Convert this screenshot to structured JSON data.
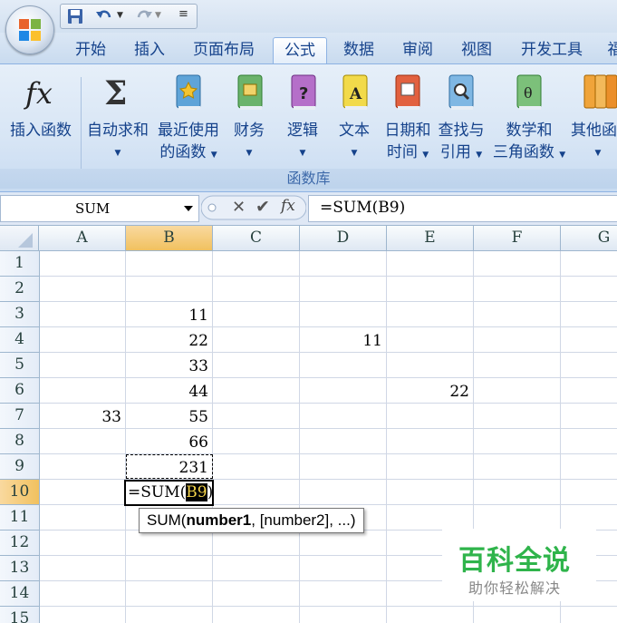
{
  "quick_access": {
    "save_icon": "save-icon",
    "undo_icon": "undo-icon",
    "redo_icon": "redo-icon",
    "customize_icon": "customize-qat-icon"
  },
  "tabs": [
    {
      "label": "开始",
      "active": false
    },
    {
      "label": "插入",
      "active": false
    },
    {
      "label": "页面布局",
      "active": false
    },
    {
      "label": "公式",
      "active": true
    },
    {
      "label": "数据",
      "active": false
    },
    {
      "label": "审阅",
      "active": false
    },
    {
      "label": "视图",
      "active": false
    },
    {
      "label": "开发工具",
      "active": false
    },
    {
      "label": "福",
      "active": false
    }
  ],
  "ribbon": {
    "insert_function": {
      "line1": "插入函数"
    },
    "autosum": {
      "line1": "自动求和"
    },
    "recent": {
      "line1": "最近使用",
      "line2": "的函数"
    },
    "financial": {
      "line1": "财务"
    },
    "logical": {
      "line1": "逻辑"
    },
    "text": {
      "line1": "文本"
    },
    "datetime": {
      "line1": "日期和",
      "line2": "时间"
    },
    "lookup": {
      "line1": "查找与",
      "line2": "引用"
    },
    "math": {
      "line1": "数学和",
      "line2": "三角函数"
    },
    "more": {
      "line1": "其他函"
    },
    "group_label": "函数库"
  },
  "formula_bar": {
    "name_box": "SUM",
    "formula": "=SUM(B9)",
    "fx": "fx"
  },
  "columns": [
    "A",
    "B",
    "C",
    "D",
    "E",
    "F",
    "G"
  ],
  "rows": [
    "1",
    "2",
    "3",
    "4",
    "5",
    "6",
    "7",
    "8",
    "9",
    "10",
    "11",
    "12",
    "13",
    "14",
    "15"
  ],
  "cells": {
    "B3": "11",
    "B4": "22",
    "B5": "33",
    "B6": "44",
    "B7": "55",
    "B8": "66",
    "B9": "231",
    "D4": "11",
    "E6": "22",
    "A7": "33"
  },
  "editing_cell": {
    "prefix": "=SUM(",
    "ref": "B9",
    "suffix": ")"
  },
  "tooltip": {
    "func": "SUM(",
    "arg1": "number1",
    "rest": ", [number2], ...)"
  },
  "watermark": {
    "title": "百科全说",
    "subtitle": "助你轻松解决"
  },
  "colors": {
    "ribbon_text": "#15428b",
    "selected_header": "#f1c15f",
    "watermark_green": "#2fb44b"
  }
}
